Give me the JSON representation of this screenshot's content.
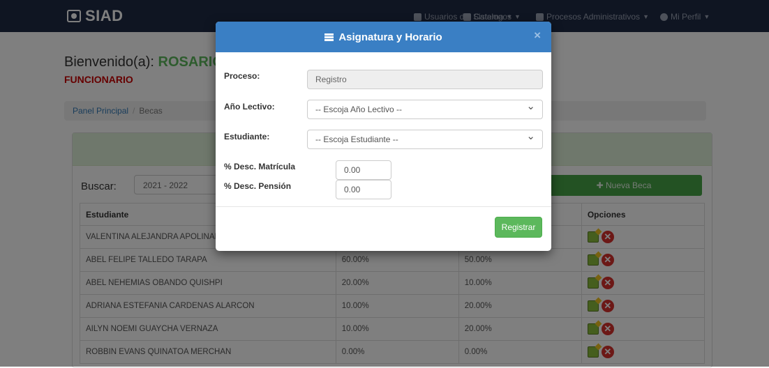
{
  "navbar": {
    "brand": "SIAD",
    "menus": [
      {
        "label": "Usuarios del Sistema"
      },
      {
        "label": "Catalogos"
      },
      {
        "label": "Procesos Administrativos"
      },
      {
        "label": "Mi Perfil"
      }
    ]
  },
  "welcome": {
    "prefix": "Bienvenido(a):",
    "name": "ROSARIO",
    "role": "FUNCIONARIO"
  },
  "breadcrumb": {
    "home": "Panel Principal",
    "current": "Becas"
  },
  "search": {
    "label": "Buscar:",
    "year": "2021 - 2022"
  },
  "new_button": "Nueva Beca",
  "table": {
    "headers": [
      "Estudiante",
      "",
      "",
      "Opciones"
    ],
    "rows": [
      {
        "student": "VALENTINA ALEJANDRA APOLINARIO",
        "mat": "",
        "pen": ""
      },
      {
        "student": "ABEL FELIPE TALLEDO TARAPA",
        "mat": "60.00%",
        "pen": "50.00%"
      },
      {
        "student": "ABEL NEHEMIAS OBANDO QUISHPI",
        "mat": "20.00%",
        "pen": "10.00%"
      },
      {
        "student": "ADRIANA ESTEFANIA CARDENAS ALARCON",
        "mat": "10.00%",
        "pen": "20.00%"
      },
      {
        "student": "AILYN NOEMI GUAYCHA VERNAZA",
        "mat": "10.00%",
        "pen": "20.00%"
      },
      {
        "student": "ROBBIN EVANS QUINATOA MERCHAN",
        "mat": "0.00%",
        "pen": "0.00%"
      }
    ]
  },
  "modal": {
    "title": "Asignatura y Horario",
    "close": "×",
    "proceso_label": "Proceso:",
    "proceso_value": "Registro",
    "anio_label": "Año Lectivo:",
    "anio_value": "-- Escoja Año Lectivo --",
    "estudiante_label": "Estudiante:",
    "estudiante_value": "-- Escoja Estudiante --",
    "matricula_label": "% Desc. Matrícula",
    "matricula_value": "0.00",
    "pension_label": "% Desc. Pensión",
    "pension_value": "0.00",
    "register": "Registrar"
  },
  "colors": {
    "navbar": "#1f2a44",
    "modal_header": "#3a7fc4",
    "success": "#5cb85c",
    "danger": "#d9312d",
    "role": "#cc0000"
  },
  "icons": [
    "logo-icon",
    "user-icon",
    "file-icon",
    "list-icon",
    "plus-icon",
    "edit-icon",
    "delete-icon",
    "chevron-down-icon",
    "close-icon"
  ]
}
